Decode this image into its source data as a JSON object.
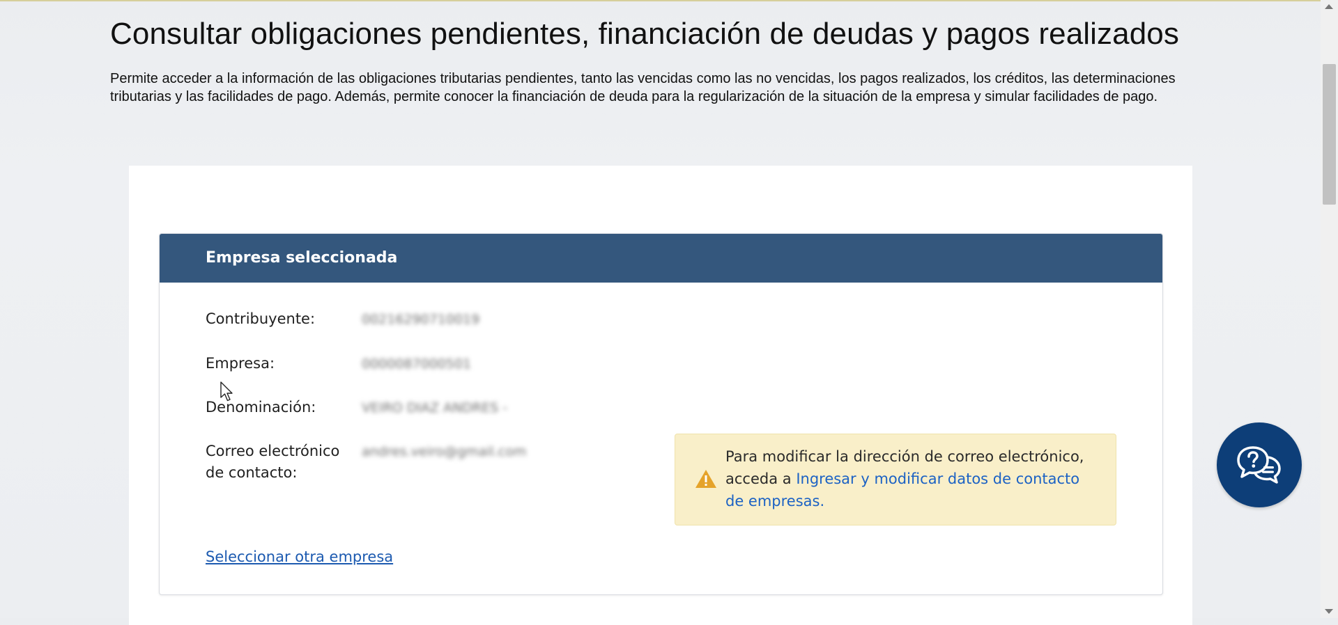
{
  "page": {
    "title": "Consultar obligaciones pendientes, financiación de deudas y pagos realizados",
    "description": "Permite acceder a la información de las obligaciones tributarias pendientes, tanto las vencidas como las no vencidas, los pagos realizados, los créditos, las determinaciones tributarias y las facilidades de pago. Además, permite conocer la financiación de deuda para la regularización de la situación de la empresa y simular facilidades de pago."
  },
  "company_panel": {
    "title": "Empresa seleccionada",
    "fields": [
      {
        "label": "Contribuyente:",
        "value": "00216290710019"
      },
      {
        "label": "Empresa:",
        "value": "0000087000501"
      },
      {
        "label": "Denominación:",
        "value": "VEIRO DIAZ ANDRES -"
      },
      {
        "label": "Correo electrónico de contacto:",
        "value": "andres.veiro@gmail.com"
      }
    ],
    "warning": {
      "text": "Para modificar la dirección de correo electrónico, acceda a ",
      "link": "Ingresar y modificar datos de contacto de empresas."
    },
    "select_other_link": "Seleccionar otra empresa"
  },
  "icons": {
    "warning": "warning-triangle-icon",
    "chat": "chat-help-icon",
    "cursor": "mouse-pointer-icon"
  },
  "colors": {
    "panel_header": "#34577d",
    "chat_button": "#0d3e78",
    "link": "#1c5ab0",
    "warning_bg": "#f9efc9",
    "warning_icon": "#e5a32a"
  }
}
